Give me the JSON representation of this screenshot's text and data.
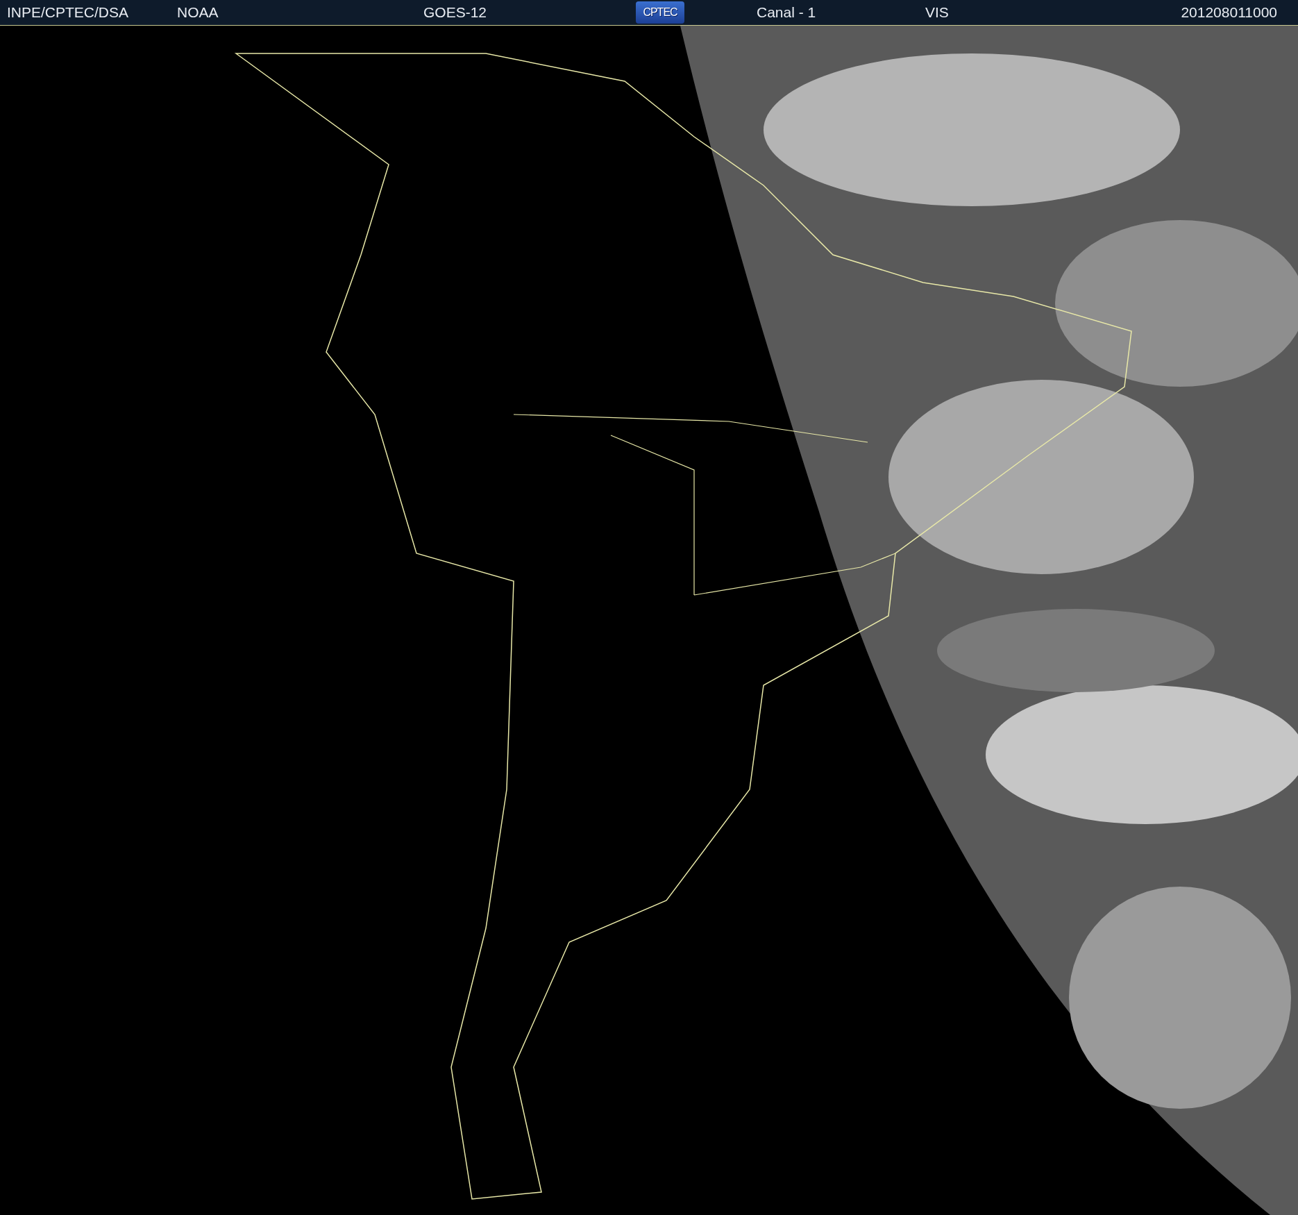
{
  "header": {
    "source": "INPE/CPTEC/DSA",
    "agency": "NOAA",
    "satellite": "GOES-12",
    "logo": "CPTEC",
    "channel": "Canal - 1",
    "band": "VIS",
    "timestamp": "201208011000"
  }
}
